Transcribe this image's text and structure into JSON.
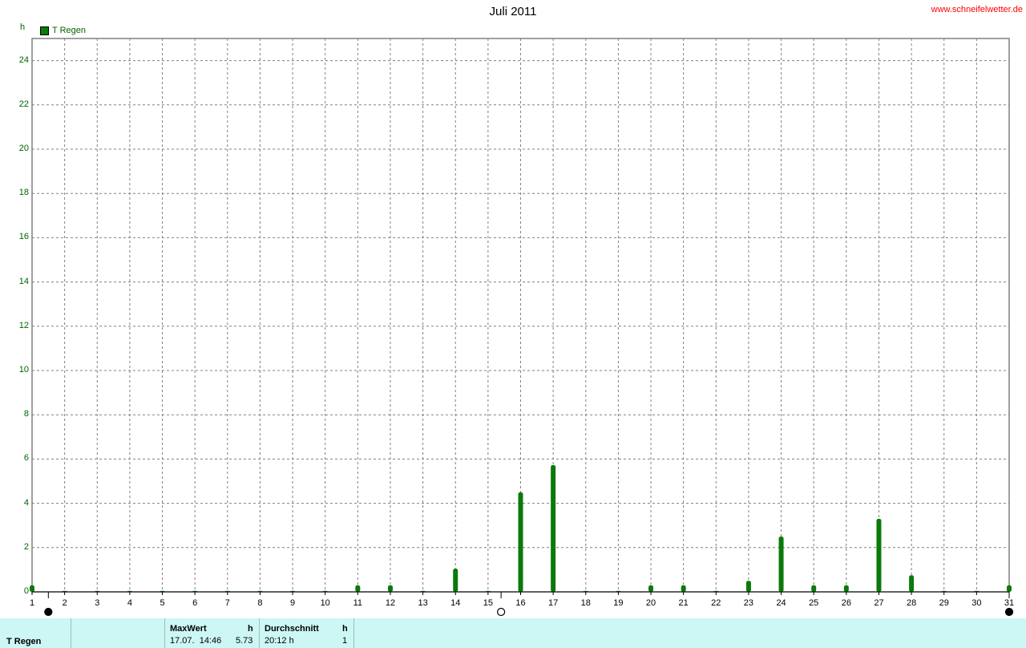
{
  "header": {
    "title": "Juli 2011",
    "site": "www.schneifelwetter.de"
  },
  "legend": {
    "unit": "h",
    "label": "T Regen",
    "color": "#0a7a0a"
  },
  "footer": {
    "series_label": "T Regen",
    "max_header": "MaxWert",
    "max_unit": "h",
    "max_time": "17.07.  14:46",
    "max_value": "5.73",
    "avg_header": "Durchschnitt",
    "avg_unit": "h",
    "avg_time": "20:12 h",
    "avg_value": "1"
  },
  "chart_data": {
    "type": "bar",
    "title": "Juli 2011",
    "xlabel": "",
    "ylabel": "h",
    "ylim": [
      0,
      25
    ],
    "yticks": [
      0,
      2,
      4,
      6,
      8,
      10,
      12,
      14,
      16,
      18,
      20,
      22,
      24
    ],
    "grid": true,
    "legend_placement": "top-left",
    "moon_phases": [
      {
        "day": 1.5,
        "phase": "new-moon"
      },
      {
        "day": 15.4,
        "phase": "full-moon"
      },
      {
        "day": 31,
        "phase": "new-moon"
      }
    ],
    "series": [
      {
        "name": "T Regen",
        "color": "#0a7a0a",
        "x": [
          1,
          2,
          3,
          4,
          5,
          6,
          7,
          8,
          9,
          10,
          11,
          12,
          13,
          14,
          15,
          16,
          17,
          18,
          19,
          20,
          21,
          22,
          23,
          24,
          25,
          26,
          27,
          28,
          29,
          30,
          31
        ],
        "values": [
          0.3,
          0,
          0,
          0,
          0,
          0,
          0,
          0,
          0,
          0,
          0.3,
          0.3,
          0,
          1.05,
          0,
          4.5,
          5.73,
          0,
          0,
          0.3,
          0.3,
          0,
          0.5,
          2.5,
          0.3,
          0.3,
          3.3,
          0.75,
          0,
          0,
          0.3
        ]
      }
    ]
  }
}
